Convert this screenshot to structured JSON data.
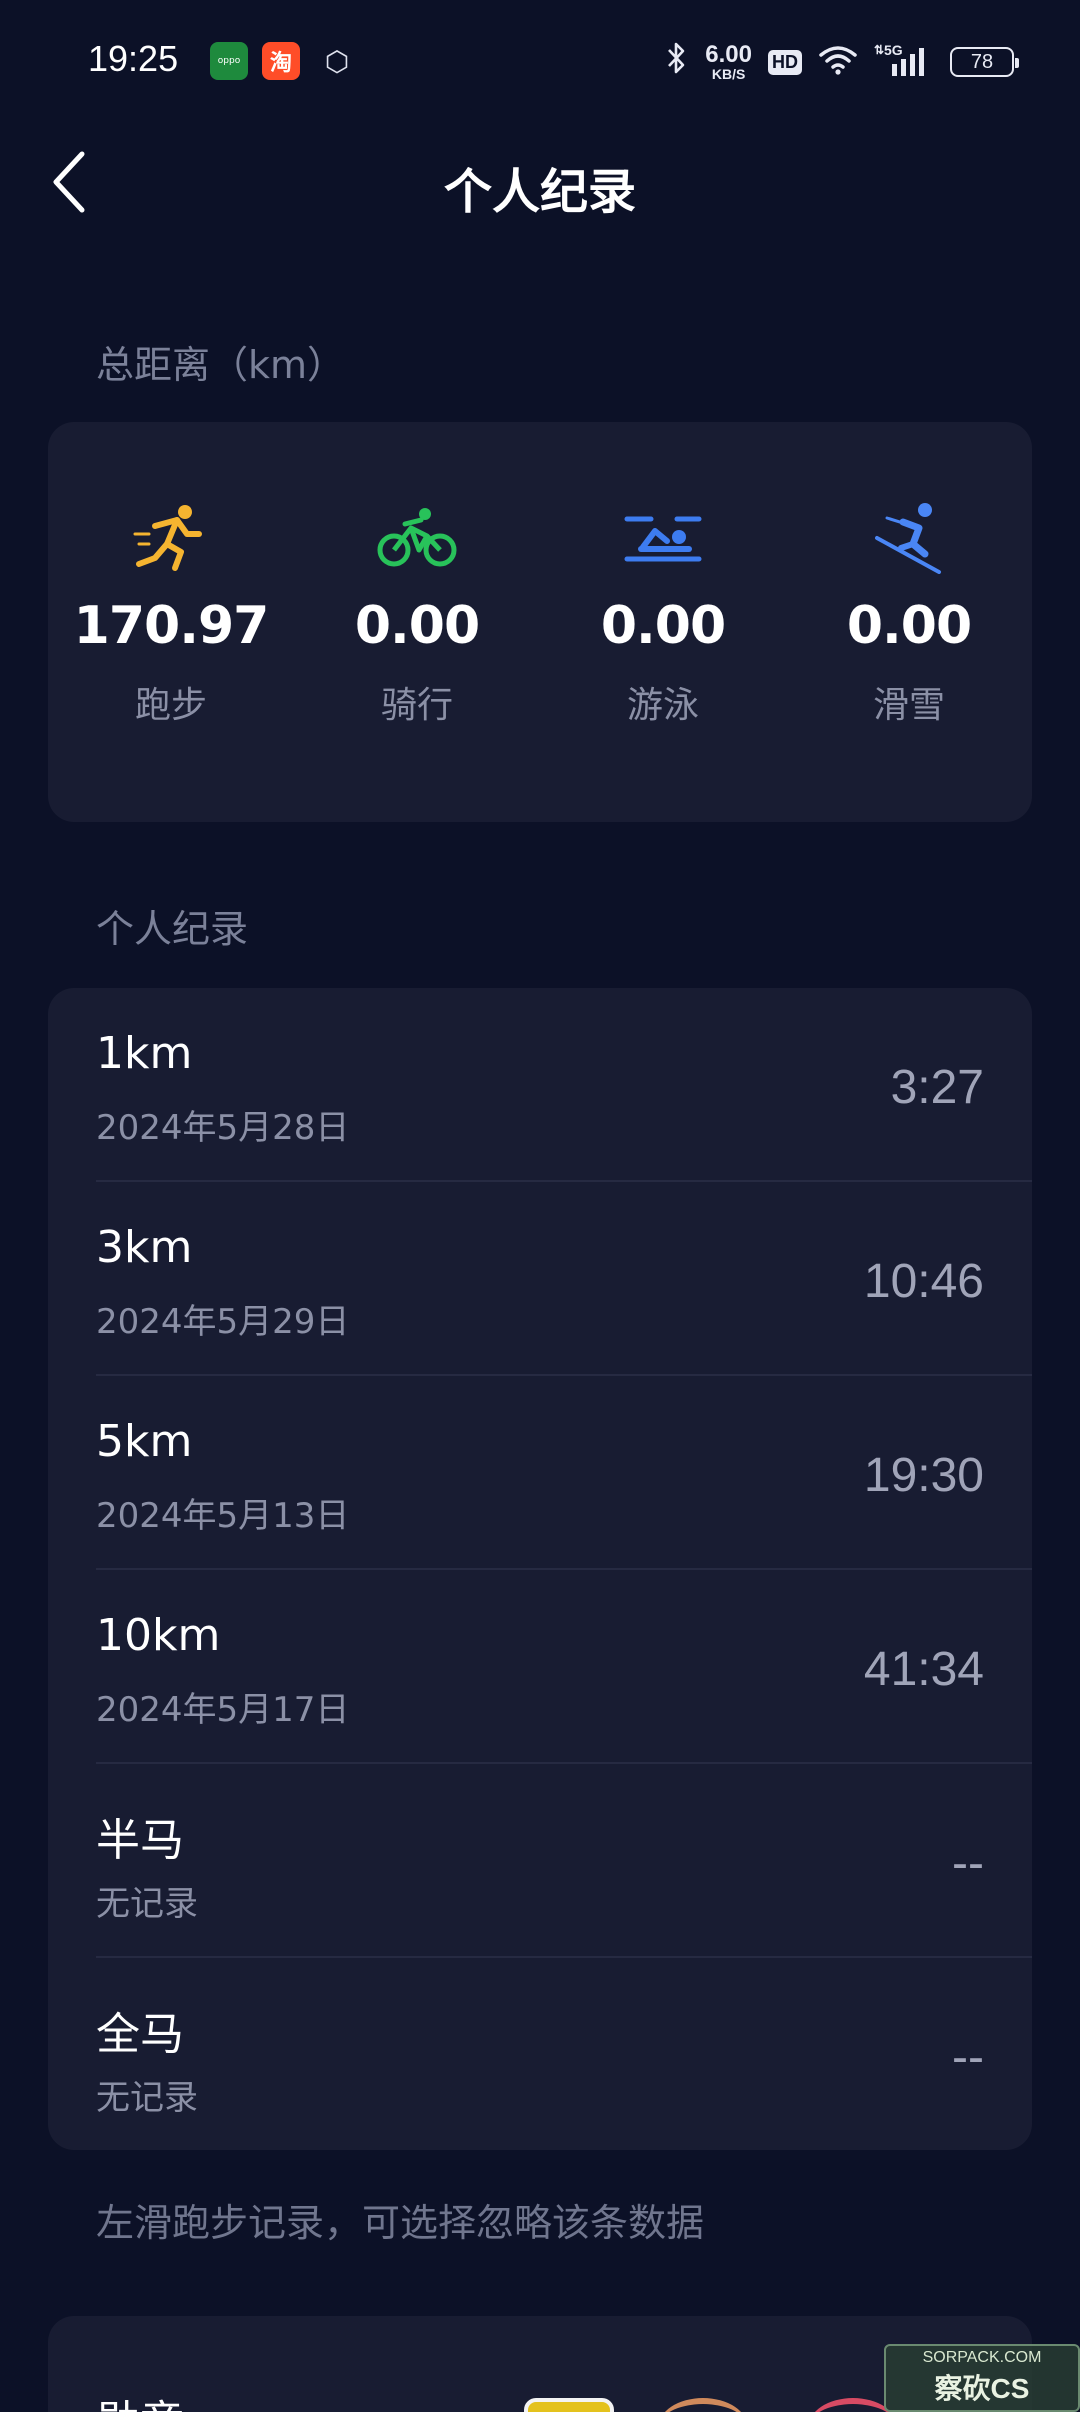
{
  "status_bar": {
    "time": "19:25",
    "apps": [
      {
        "icon": "oppo-app-icon",
        "label": "oppo"
      },
      {
        "icon": "taobao-app-icon",
        "label": "淘"
      },
      {
        "icon": "hexagon-app-icon",
        "label": "⬡"
      }
    ],
    "net_speed": "6.00",
    "net_unit": "KB/S",
    "hd": "HD",
    "signal": "5G",
    "battery": "78"
  },
  "header": {
    "title": "个人纪录",
    "back_icon": "chevron-left-icon"
  },
  "distance_section": {
    "label": "总距离（km）",
    "sports": [
      {
        "label": "跑步",
        "value": "170.97",
        "icon": "running-icon",
        "color": "#f5b430"
      },
      {
        "label": "骑行",
        "value": "0.00",
        "icon": "cycling-icon",
        "color": "#28c25a"
      },
      {
        "label": "游泳",
        "value": "0.00",
        "icon": "swimming-icon",
        "color": "#3d7cf0"
      },
      {
        "label": "滑雪",
        "value": "0.00",
        "icon": "skiing-icon",
        "color": "#4a86f5"
      }
    ]
  },
  "records_section": {
    "label": "个人纪录",
    "records": [
      {
        "name": "1km",
        "date": "2024年5月28日",
        "time": "3:27"
      },
      {
        "name": "3km",
        "date": "2024年5月29日",
        "time": "10:46"
      },
      {
        "name": "5km",
        "date": "2024年5月13日",
        "time": "19:30"
      },
      {
        "name": "10km",
        "date": "2024年5月17日",
        "time": "41:34"
      },
      {
        "name": "半马",
        "date": "无记录",
        "time": "--"
      },
      {
        "name": "全马",
        "date": "无记录",
        "time": "--"
      }
    ]
  },
  "hint": "左滑跑步记录，可选择忽略该条数据",
  "bottom_card": {
    "label": "勋章"
  },
  "watermark": {
    "site": "SORPACK.COM",
    "logo": "察砍CS"
  }
}
